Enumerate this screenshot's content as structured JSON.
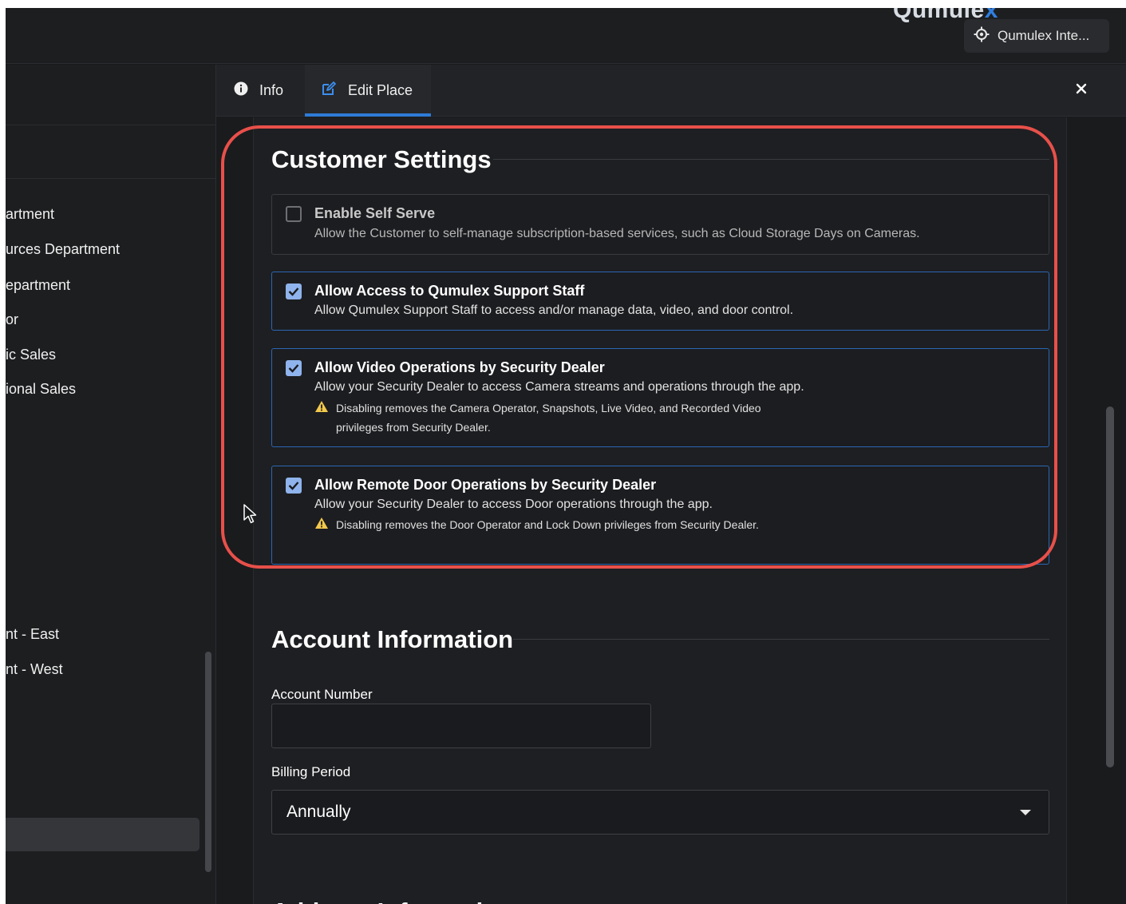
{
  "header": {
    "logo_text": "Qumulex",
    "org_button_label": "Qumulex Inte..."
  },
  "sidebar": {
    "items": [
      {
        "label": "artment"
      },
      {
        "label": "urces Department"
      },
      {
        "label": "epartment"
      },
      {
        "label": "or"
      },
      {
        "label": "ic Sales"
      },
      {
        "label": "ional Sales"
      },
      {
        "label": "nt - East"
      },
      {
        "label": "nt - West"
      }
    ]
  },
  "drawer": {
    "tabs": [
      {
        "label": "Info",
        "icon": "info-icon"
      },
      {
        "label": "Edit Place",
        "icon": "edit-icon",
        "active": true
      }
    ],
    "close_label": "×"
  },
  "customer_settings": {
    "title": "Customer Settings",
    "items": [
      {
        "title": "Enable Self Serve",
        "description": "Allow the Customer to self-manage subscription-based services, such as Cloud Storage Days on Cameras.",
        "checked": false
      },
      {
        "title": "Allow Access to Qumulex Support Staff",
        "description": "Allow Qumulex Support Staff to access and/or manage data, video, and door control.",
        "checked": true
      },
      {
        "title": "Allow Video Operations by Security Dealer",
        "description": "Allow your Security Dealer to access Camera streams and operations through the app.",
        "warning": "Disabling removes the Camera Operator, Snapshots, Live Video, and Recorded Video privileges from Security Dealer.",
        "checked": true
      },
      {
        "title": "Allow Remote Door Operations by Security Dealer",
        "description": "Allow your Security Dealer to access Door operations through the app.",
        "warning": "Disabling removes the Door Operator and Lock Down privileges from Security Dealer.",
        "checked": true
      }
    ]
  },
  "account_information": {
    "title": "Account Information",
    "account_number_label": "Account Number",
    "account_number_value": "",
    "billing_period_label": "Billing Period",
    "billing_period_value": "Annually"
  },
  "address_information": {
    "title": "Address Information"
  },
  "colors": {
    "accent": "#2e7bd6",
    "highlight_ring": "#e8504a",
    "warning": "#f2c94c",
    "background": "#1e1f22"
  }
}
